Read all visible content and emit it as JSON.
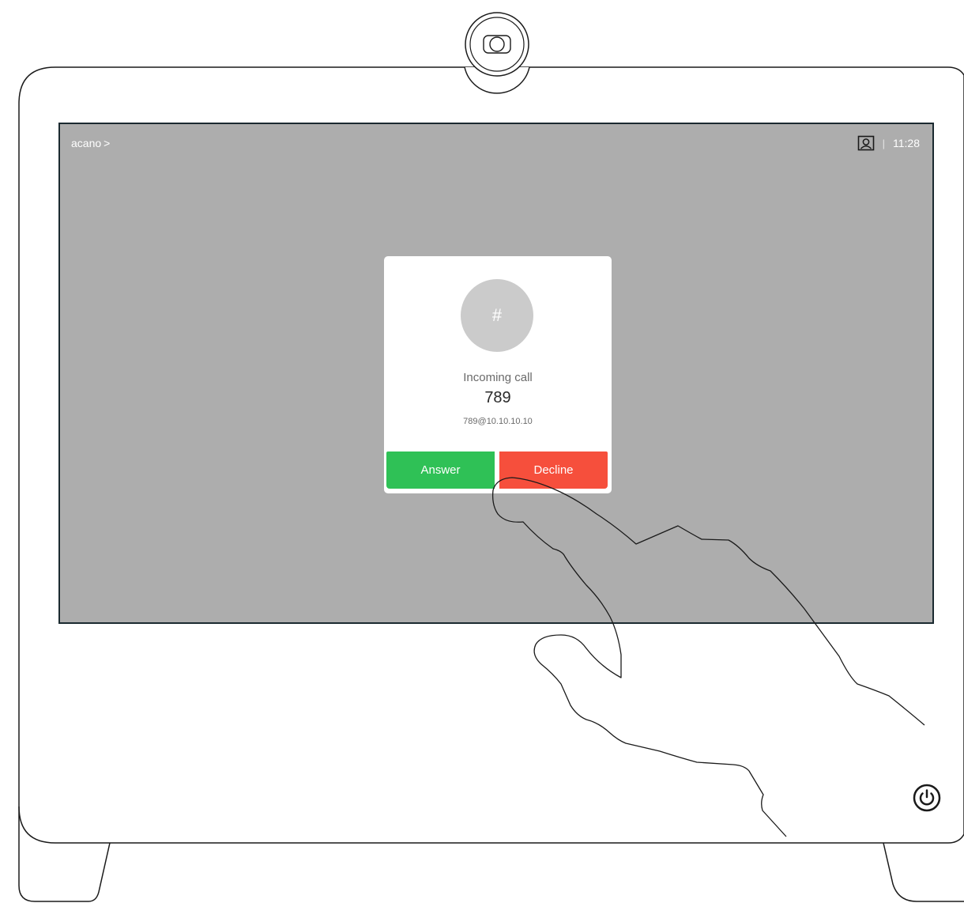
{
  "status_bar": {
    "contact_label": "acano",
    "contact_chevron": ">",
    "selfview_icon": "selfview-icon",
    "separator": "|",
    "time": "11:28"
  },
  "incoming_call": {
    "avatar_symbol": "#",
    "subtitle": "Incoming call",
    "caller_name": "789",
    "caller_uri": "789@10.10.10.10",
    "answer_label": "Answer",
    "decline_label": "Decline"
  },
  "device": {
    "camera_icon": "camera-icon",
    "power_icon": "power-icon"
  },
  "colors": {
    "screen_bg": "#adadad",
    "answer": "#2fc156",
    "decline": "#f64f3c",
    "avatar": "#cbcbcb",
    "bezel_outline": "#1b2a30"
  }
}
